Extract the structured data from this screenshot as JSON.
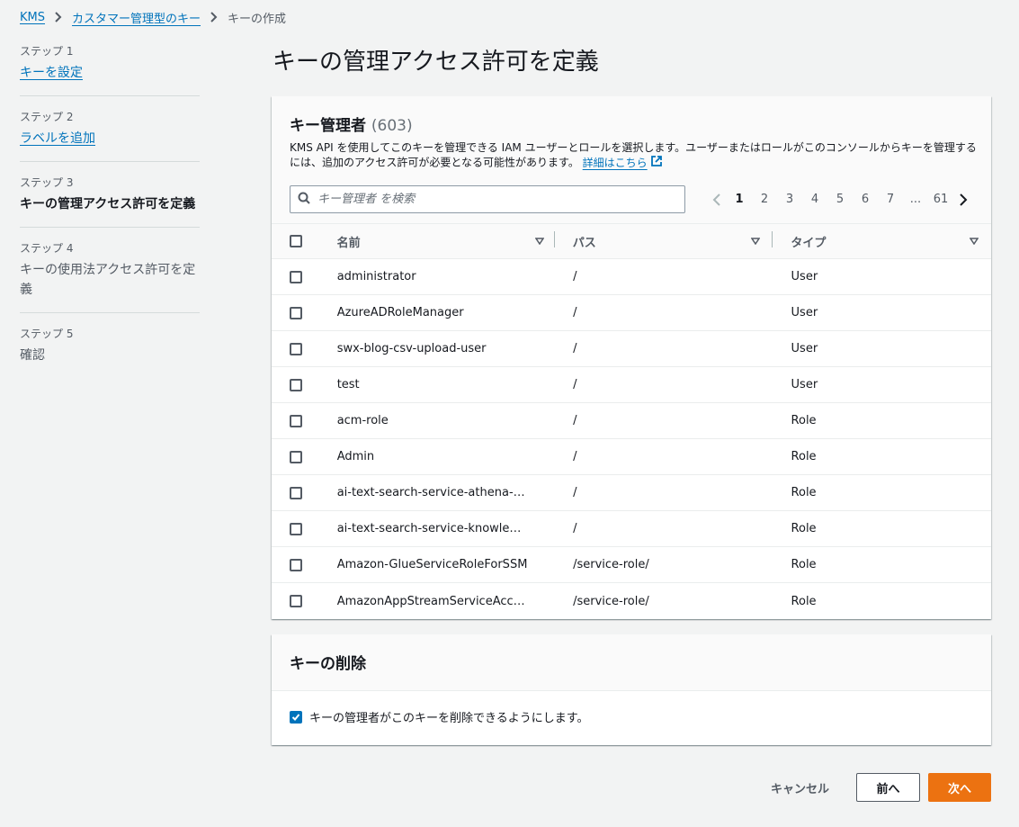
{
  "breadcrumb": {
    "items": [
      "KMS",
      "カスタマー管理型のキー"
    ],
    "current": "キーの作成"
  },
  "steps": [
    {
      "num": "ステップ 1",
      "title": "キーを設定",
      "state": "link"
    },
    {
      "num": "ステップ 2",
      "title": "ラベルを追加",
      "state": "link"
    },
    {
      "num": "ステップ 3",
      "title": "キーの管理アクセス許可を定義",
      "state": "active"
    },
    {
      "num": "ステップ 4",
      "title": "キーの使用法アクセス許可を定義",
      "state": "plain"
    },
    {
      "num": "ステップ 5",
      "title": "確認",
      "state": "plain"
    }
  ],
  "page_title": "キーの管理アクセス許可を定義",
  "admins": {
    "title": "キー管理者",
    "count": "(603)",
    "description": "KMS API を使用してこのキーを管理できる IAM ユーザーとロールを選択します。ユーザーまたはロールがこのコンソールからキーを管理するには、追加のアクセス許可が必要となる可能性があります。",
    "learn_more": "詳細はこちら",
    "search_placeholder": "キー管理者 を検索",
    "pagination": {
      "pages": [
        "1",
        "2",
        "3",
        "4",
        "5",
        "6",
        "7",
        "...",
        "61"
      ],
      "current": "1"
    },
    "columns": [
      "名前",
      "パス",
      "タイプ"
    ],
    "rows": [
      {
        "name": "administrator",
        "path": "/",
        "type": "User"
      },
      {
        "name": "AzureADRoleManager",
        "path": "/",
        "type": "User"
      },
      {
        "name": "swx-blog-csv-upload-user",
        "path": "/",
        "type": "User"
      },
      {
        "name": "test",
        "path": "/",
        "type": "User"
      },
      {
        "name": "acm-role",
        "path": "/",
        "type": "Role"
      },
      {
        "name": "Admin",
        "path": "/",
        "type": "Role"
      },
      {
        "name": "ai-text-search-service-athena-…",
        "path": "/",
        "type": "Role"
      },
      {
        "name": "ai-text-search-service-knowle…",
        "path": "/",
        "type": "Role"
      },
      {
        "name": "Amazon-GlueServiceRoleForSSM",
        "path": "/service-role/",
        "type": "Role"
      },
      {
        "name": "AmazonAppStreamServiceAcc…",
        "path": "/service-role/",
        "type": "Role"
      }
    ]
  },
  "deletion": {
    "title": "キーの削除",
    "checkbox_label": "キーの管理者がこのキーを削除できるようにします。",
    "checked": true
  },
  "footer": {
    "cancel": "キャンセル",
    "previous": "前へ",
    "next": "次へ"
  },
  "colors": {
    "link": "#0073bb",
    "primary_button": "#ec7211",
    "background": "#f2f3f3"
  }
}
